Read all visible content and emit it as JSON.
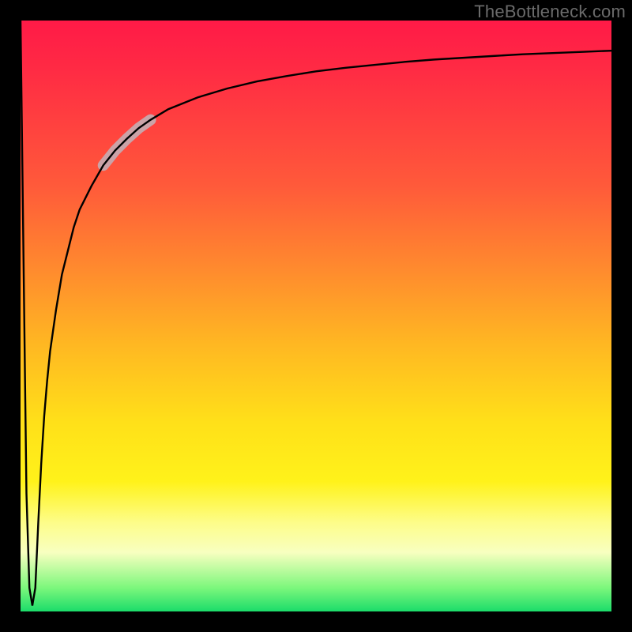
{
  "watermark": "TheBottleneck.com",
  "colors": {
    "frame": "#000000",
    "curve": "#000000",
    "highlight": "#caa3a8",
    "gradient_stops": [
      "#ff1a47",
      "#ff5a3a",
      "#ff8a2e",
      "#ffb822",
      "#ffe019",
      "#fff21a",
      "#fdfd8a",
      "#f8ffc0",
      "#7cf77c",
      "#1bdc6a"
    ]
  },
  "chart_data": {
    "type": "line",
    "title": "",
    "xlabel": "",
    "ylabel": "",
    "xlim": [
      0,
      100
    ],
    "ylim": [
      0,
      100
    ],
    "grid": false,
    "x": [
      0,
      0.5,
      1,
      1.5,
      2,
      2.5,
      3,
      3.5,
      4,
      4.5,
      5,
      6,
      7,
      8,
      9,
      10,
      12,
      14,
      16,
      18,
      20,
      22,
      25,
      30,
      35,
      40,
      45,
      50,
      55,
      60,
      65,
      70,
      75,
      80,
      85,
      90,
      95,
      100
    ],
    "values": [
      100,
      60,
      20,
      4,
      1,
      4,
      15,
      25,
      33,
      39,
      44,
      51,
      57,
      61,
      65,
      68,
      72,
      75.5,
      78,
      80,
      81.8,
      83.2,
      85,
      87,
      88.5,
      89.7,
      90.6,
      91.4,
      92,
      92.5,
      93,
      93.4,
      93.7,
      94,
      94.3,
      94.5,
      94.7,
      94.9
    ],
    "annotations": [
      {
        "name": "highlight-segment",
        "x_range": [
          14,
          22
        ],
        "approx_y_range": [
          75,
          83
        ],
        "style": "thick-pale"
      }
    ]
  }
}
